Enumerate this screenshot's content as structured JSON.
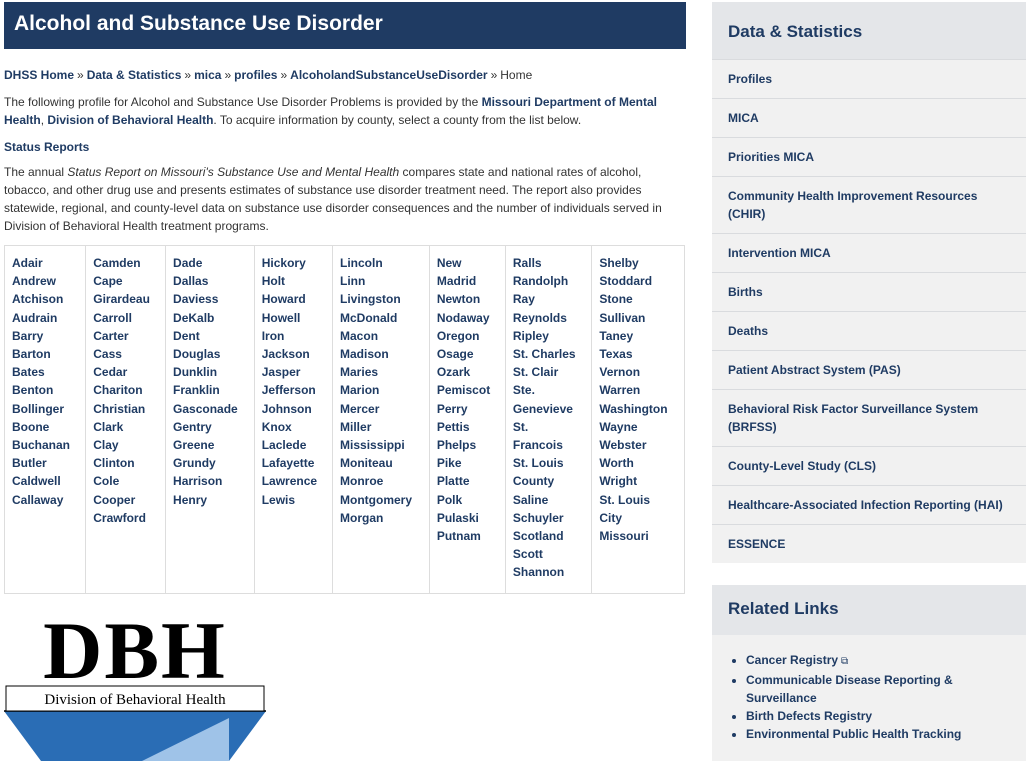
{
  "page_title": "Alcohol and Substance Use Disorder",
  "breadcrumb": {
    "items": [
      "DHSS Home",
      "Data & Statistics",
      "mica",
      "profiles",
      "AlcoholandSubstanceUseDisorder"
    ],
    "separator": "»",
    "current": "Home"
  },
  "intro": {
    "part1": "The following profile for Alcohol and Substance Use Disorder Problems is provided by the ",
    "org1": "Missouri Department of Mental Health",
    "comma": ", ",
    "org2": "Division of Behavioral Health",
    "part2": ". To acquire information by county, select a county from the list below."
  },
  "status": {
    "heading": "Status Reports",
    "part1": "The annual ",
    "report_title": "Status Report on Missouri's Substance Use and Mental Health",
    "part2": " compares state and national rates of alcohol, tobacco, and other drug use and presents estimates of substance use disorder treatment need. The report also provides statewide, regional, and county-level data on substance use disorder consequences and the number of individuals served in Division of Behavioral Health treatment programs."
  },
  "counties": [
    [
      "Adair",
      "Andrew",
      "Atchison",
      "Audrain",
      "Barry",
      "Barton",
      "Bates",
      "Benton",
      "Bollinger",
      "Boone",
      "Buchanan",
      "Butler",
      "Caldwell",
      "Callaway"
    ],
    [
      "Camden",
      "Cape",
      "Girardeau",
      "Carroll",
      "Carter",
      "Cass",
      "Cedar",
      "Chariton",
      "Christian",
      "Clark",
      "Clay",
      "Clinton",
      "Cole",
      "Cooper",
      "Crawford"
    ],
    [
      "Dade",
      "Dallas",
      "Daviess",
      "DeKalb",
      "Dent",
      "Douglas",
      "Dunklin",
      "Franklin",
      "Gasconade",
      "Gentry",
      "Greene",
      "Grundy",
      "Harrison",
      "Henry"
    ],
    [
      "Hickory",
      "Holt",
      "Howard",
      "Howell",
      "Iron",
      "Jackson",
      "Jasper",
      "Jefferson",
      "Johnson",
      "Knox",
      "Laclede",
      "Lafayette",
      "Lawrence",
      "Lewis"
    ],
    [
      "Lincoln",
      "Linn",
      "Livingston",
      "McDonald",
      "Macon",
      "Madison",
      "Maries",
      "Marion",
      "Mercer",
      "Miller",
      "Mississippi",
      "Moniteau",
      "Monroe",
      "Montgomery",
      "Morgan"
    ],
    [
      "New",
      "Madrid",
      "Newton",
      "Nodaway",
      "Oregon",
      "Osage",
      "Ozark",
      "Pemiscot",
      "Perry",
      "Pettis",
      "Phelps",
      "Pike",
      "Platte",
      "Polk",
      "Pulaski",
      "Putnam"
    ],
    [
      "Ralls",
      "Randolph",
      "Ray",
      "Reynolds",
      "Ripley",
      "St. Charles",
      "St. Clair",
      "Ste.",
      "Genevieve",
      "St.",
      "Francois",
      "St. Louis",
      "County",
      "Saline",
      "Schuyler",
      "Scotland",
      "Scott",
      "Shannon"
    ],
    [
      "Shelby",
      "Stoddard",
      "Stone",
      "Sullivan",
      "Taney",
      "Texas",
      "Vernon",
      "Warren",
      "Washington",
      "Wayne",
      "Webster",
      "Worth",
      "Wright",
      "St. Louis",
      "City",
      "Missouri"
    ]
  ],
  "logo": {
    "letters": "DBH",
    "caption": "Division of Behavioral Health"
  },
  "sidebar": {
    "title": "Data & Statistics",
    "items": [
      "Profiles",
      "MICA",
      "Priorities MICA",
      "Community Health Improvement Resources (CHIR)",
      "Intervention MICA",
      "Births",
      "Deaths",
      "Patient Abstract System (PAS)",
      "Behavioral Risk Factor Surveillance System (BRFSS)",
      "County-Level Study (CLS)",
      "Healthcare-Associated Infection Reporting (HAI)",
      "ESSENCE"
    ]
  },
  "related": {
    "title": "Related Links",
    "items": [
      "Cancer Registry",
      "Communicable Disease Reporting & Surveillance",
      "Birth Defects Registry",
      "Environmental Public Health Tracking"
    ],
    "external_icon": "external-link-icon"
  },
  "colors": {
    "brand_navy": "#1f3b63",
    "sidebar_bg": "#f1f1f1",
    "sidebar_header_bg": "#e4e6e9",
    "logo_blue": "#2a6db5"
  }
}
